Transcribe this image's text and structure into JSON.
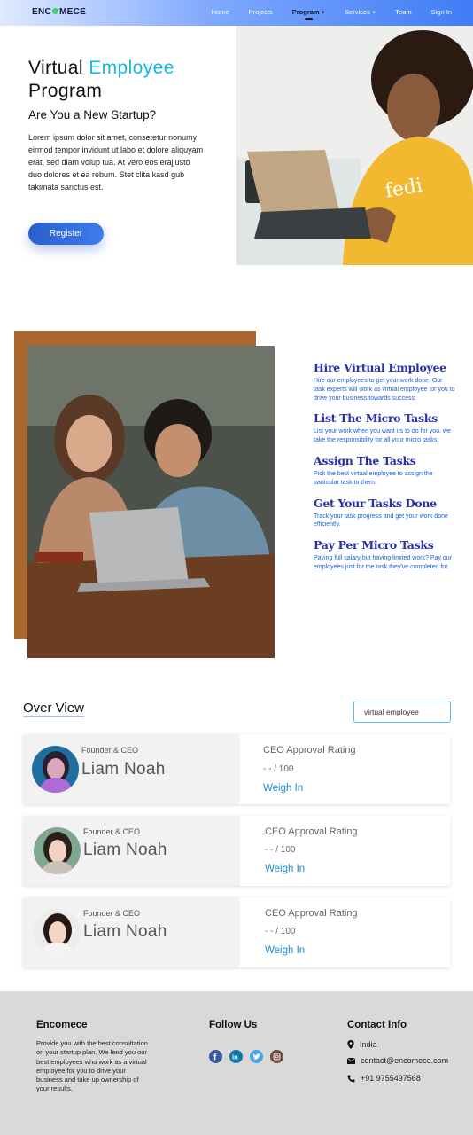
{
  "nav": {
    "brand_left": "ENC",
    "brand_right": "MECE",
    "links": [
      "Home",
      "Projects",
      "Program +",
      "Services +",
      "Team",
      "Sign In"
    ],
    "active": "Program +"
  },
  "hero": {
    "title_part1": "Virtual",
    "title_highlight": "Employee",
    "title_part2": "Program",
    "subtitle": "Are You a New Startup?",
    "body": "Lorem ipsum dolor sit amet, consetetur nonumy eirmod tempor invidunt ut labo et dolore aliquyam erat, sed diam volup tua. At vero eos erajjusto duo dolores et ea rebum. Stet clita kasd gub takimata sanctus est.",
    "register_label": "Register",
    "laptop_text": "fedi"
  },
  "steps": [
    {
      "title": "Hire Virtual Employee",
      "desc": "Hire our employees to get your work done. Our task experts will work as virtual employee for you to drive your business towards success."
    },
    {
      "title": "List The Micro Tasks",
      "desc": "List your work when you want us to do for you. we take the responsibility for all your micro tasks."
    },
    {
      "title": "Assign The Tasks",
      "desc": "Pick the best virtual employee to assign the particular task to them."
    },
    {
      "title": "Get Your Tasks Done",
      "desc": "Track your task progress and get your work done efficiently."
    },
    {
      "title": "Pay Per Micro Tasks",
      "desc": "Paying full salary but having limited work? Pay our employees just for the task they've completed for."
    }
  ],
  "overview": {
    "title": "Over View",
    "search_value": "virtual employee",
    "cards": [
      {
        "role": "Founder & CEO",
        "name": "Liam Noah",
        "rating_label": "CEO Approval Rating",
        "rating_value": "- - / 100",
        "action": "Weigh In"
      },
      {
        "role": "Founder & CEO",
        "name": "Liam Noah",
        "rating_label": "CEO Approval Rating",
        "rating_value": "- - / 100",
        "action": "Weigh In"
      },
      {
        "role": "Founder & CEO",
        "name": "Liam Noah",
        "rating_label": "CEO Approval Rating",
        "rating_value": "- - / 100",
        "action": "Weigh In"
      }
    ]
  },
  "footer": {
    "brand": "Encomece",
    "about": "Provide you with the best consultation on your startup plan. We lend you our best employees who work as a virtual employee for you to drive your business and take up ownership of your results.",
    "follow_title": "Follow Us",
    "social": [
      "facebook-icon",
      "linkedin-icon",
      "twitter-icon",
      "instagram-icon"
    ],
    "contact_title": "Contact Info",
    "location": "India",
    "email": "contact@encomece.com",
    "phone": "+91 9755497568"
  },
  "colors": {
    "accent": "#18b7e8",
    "step_title": "#2b2fa8",
    "step_desc": "#1a5fe0",
    "link": "#1c8fd3",
    "footer_bg": "#d9d9d9"
  }
}
